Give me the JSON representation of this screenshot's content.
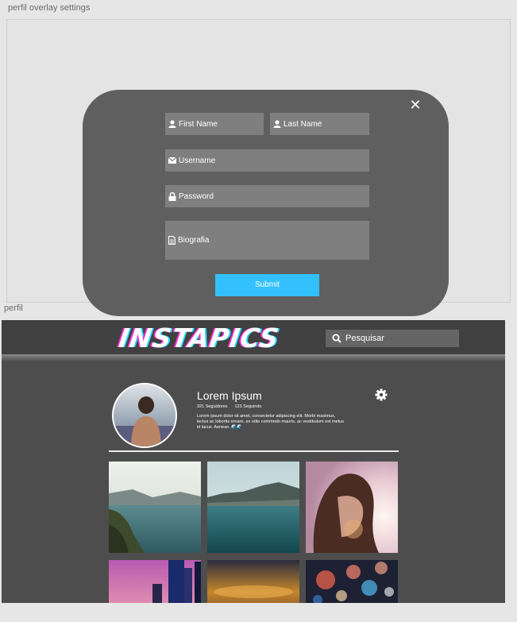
{
  "artboards": {
    "overlay_label": "perfil overlay settings",
    "profile_label": "perfil"
  },
  "overlay": {
    "close_icon": "close-icon",
    "fields": {
      "first_name": "First Name",
      "last_name": "Last Name",
      "username": "Username",
      "password": "Password",
      "bio": "Biografia"
    },
    "submit_label": "Submit",
    "colors": {
      "modal": "#5f5f5f",
      "field": "#7f7f7f",
      "submit": "#33c1fd"
    }
  },
  "header": {
    "logo": "INSTAPICS",
    "search_label": "Pesquisar"
  },
  "profile": {
    "name": "Lorem Ipsum",
    "followers": "321 Seguidores",
    "following": "123 Seguindo",
    "bio": "Lorem ipsum dolor sit amet, consectetur adipiscing elit. Morbi maximus, lectus ac lobortis ornare, ex odio commodo mauris, ac vestibulum est metus id lacus. Aenean. 🌊🌊"
  },
  "gallery": {
    "images": [
      "lake-mountains",
      "lake-hills",
      "woman-sunset",
      "city-towers",
      "sunset-clouds",
      "bokeh-lights"
    ]
  }
}
